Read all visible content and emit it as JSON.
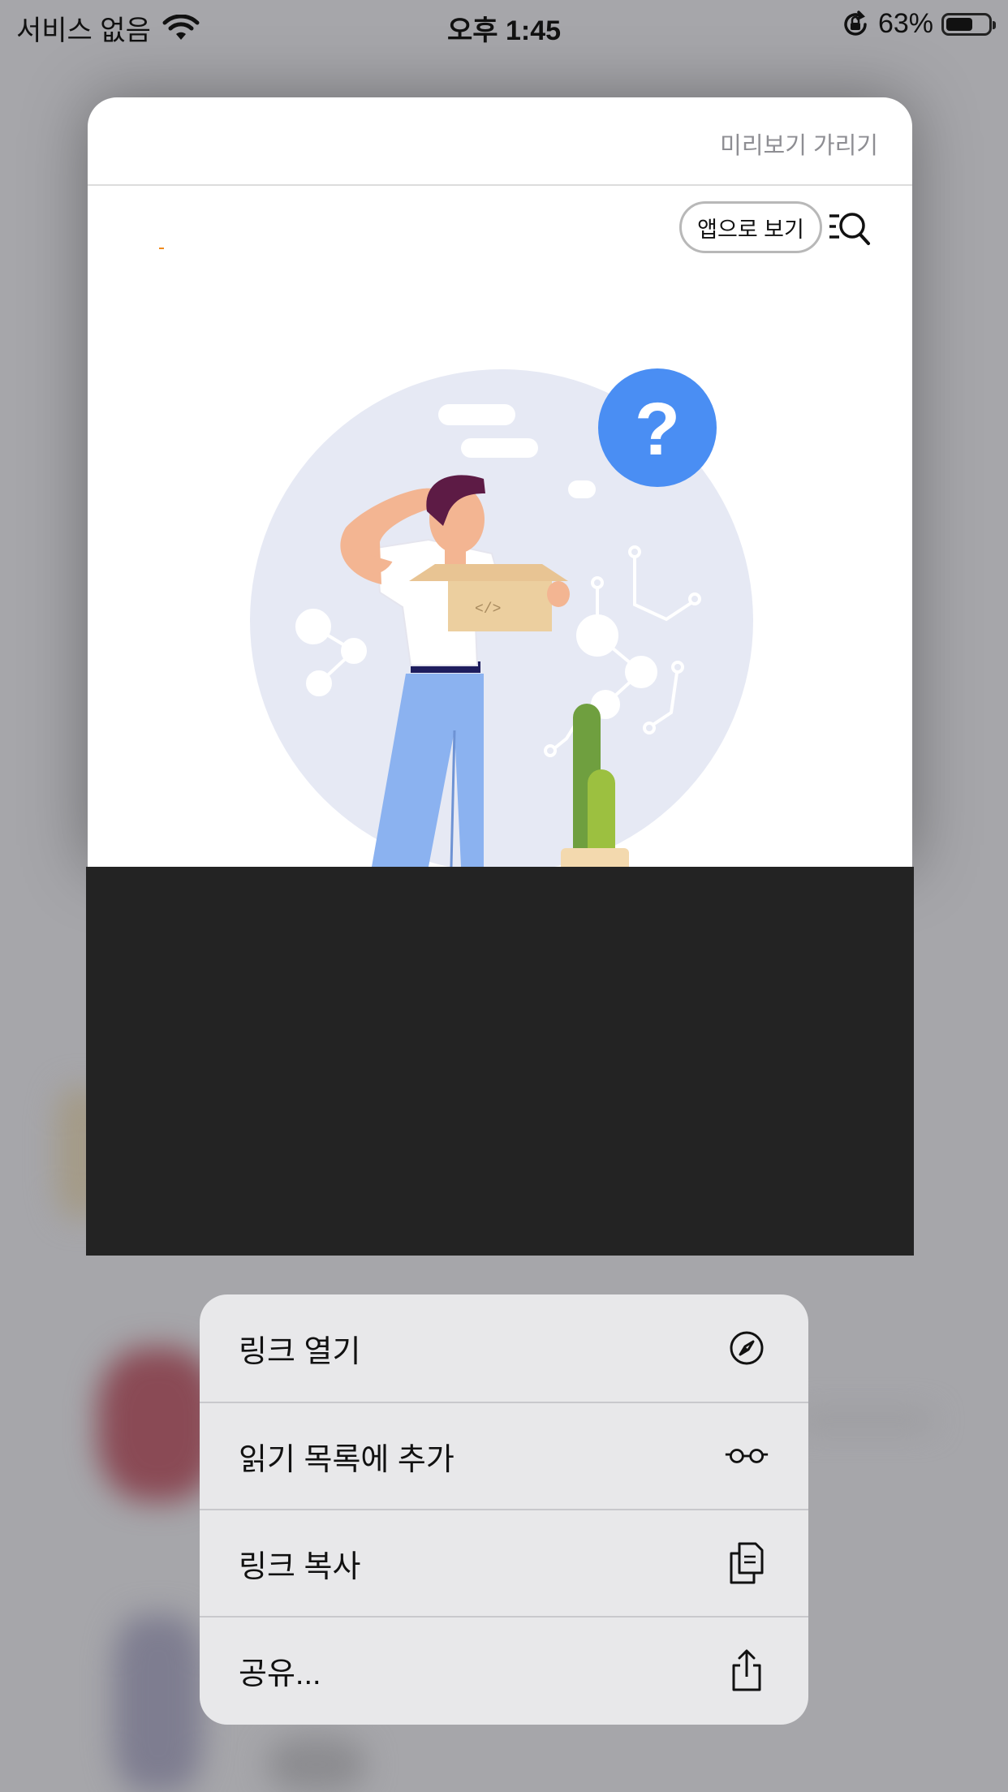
{
  "status_bar": {
    "carrier": "서비스 없음",
    "time": "오후 1:45",
    "battery_percent": "63%",
    "battery_level": 0.63
  },
  "preview": {
    "hide_preview_label": "미리보기 가리기",
    "view_in_app_label": "앱으로 보기",
    "illustration_icon": "question-mark"
  },
  "context_menu": {
    "items": [
      {
        "label": "링크 열기",
        "icon": "compass-icon"
      },
      {
        "label": "읽기 목록에 추가",
        "icon": "glasses-icon"
      },
      {
        "label": "링크 복사",
        "icon": "copy-icon"
      },
      {
        "label": "공유...",
        "icon": "share-icon"
      }
    ]
  },
  "colors": {
    "question_bubble": "#4a8ef3",
    "backdrop": "#a6a6aa",
    "dark_panel": "#232323",
    "menu_background": "#e8e8ea"
  }
}
